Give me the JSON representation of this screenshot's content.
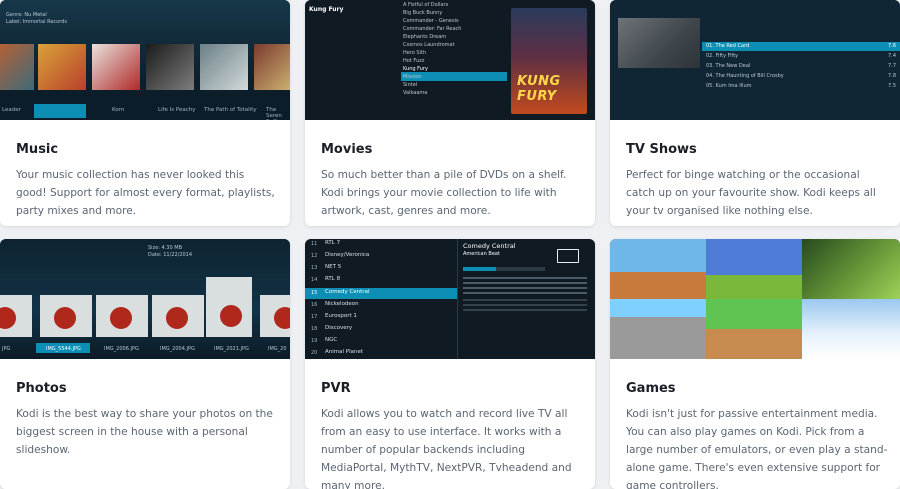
{
  "cards": [
    {
      "title": "Music",
      "description": "Your music collection has never looked this good! Support for almost every format, playlists, party mixes and more.",
      "shot": {
        "info": [
          "Genre: Nu Metal",
          "Label: Immortal Records"
        ],
        "strip": [
          "Leader",
          "Korn",
          "Life Is Peachy",
          "The Path of Totality",
          "The Seren Suffer"
        ]
      }
    },
    {
      "title": "Movies",
      "description": "So much better than a pile of DVDs on a shelf. Kodi brings your movie collection to life with artwork, cast, genres and more.",
      "shot": {
        "heading": "Kung Fury",
        "list": [
          "A Fistful of Dollars",
          "Big Buck Bunny",
          "Commander - Genesis",
          "Commander: Far Reach",
          "Elephants Dream",
          "Cosmos Laundromat",
          "Hero Sith",
          "Hot Fuzz",
          "Kung Fury",
          "Mission",
          "Sintel",
          "Valkaama"
        ],
        "poster_text": "KUNG FURY"
      }
    },
    {
      "title": "TV Shows",
      "description": "Perfect for binge watching or the occasional catch up on your favourite show. Kodi keeps all your tv organised like nothing else.",
      "shot": {
        "list": [
          "01. The Red Card",
          "02. Fifty Fifty",
          "03. The New Deal",
          "04. The Haunting of Bill Crosby",
          "05. Kum Ima Illum"
        ],
        "ratings": [
          "7.6",
          "7.4",
          "7.7",
          "7.8",
          "7.5"
        ]
      }
    },
    {
      "title": "Photos",
      "description": "Kodi is the best way to share your photos on the biggest screen in the house with a personal slideshow.",
      "shot": {
        "info": [
          "Size: 4.30 MB",
          "Date: 11/22/2014"
        ],
        "strip": [
          "JPG",
          "IMG_5544.JPG",
          "IMG_2006.JPG",
          "IMG_2004.JPG",
          "IMG_2021.JPG",
          "IMG_20"
        ]
      }
    },
    {
      "title": "PVR",
      "description": "Kodi allows you to watch and record live TV all from an easy to use interface. It works with a number of popular backends including MediaPortal, MythTV, NextPVR, Tvheadend and many more.",
      "shot": {
        "channels": [
          {
            "num": "11",
            "name": "RTL 7"
          },
          {
            "num": "12",
            "name": "Disney/Veronica"
          },
          {
            "num": "13",
            "name": "NET 5"
          },
          {
            "num": "14",
            "name": "RTL 8"
          },
          {
            "num": "15",
            "name": "Comedy Central"
          },
          {
            "num": "16",
            "name": "Nickelodeon"
          },
          {
            "num": "17",
            "name": "Eurosport 1"
          },
          {
            "num": "18",
            "name": "Discovery"
          },
          {
            "num": "19",
            "name": "NGC"
          },
          {
            "num": "20",
            "name": "Animal Planet"
          }
        ],
        "detail_title": "Comedy Central",
        "detail_sub": "American Beat"
      }
    },
    {
      "title": "Games",
      "description": "Kodi isn't just for passive entertainment media. You can also play games on Kodi. Pick from a large number of emulators, or even play a stand-alone game. There's even extensive support for game controllers."
    }
  ]
}
